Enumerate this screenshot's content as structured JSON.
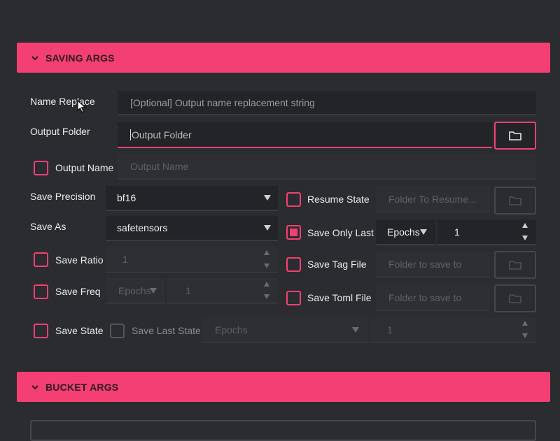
{
  "sections": {
    "saving": "SAVING ARGS",
    "bucket": "BUCKET ARGS"
  },
  "fields": {
    "name_replace": {
      "label": "Name Replace",
      "placeholder": "[Optional] Output name replacement string"
    },
    "output_folder": {
      "label": "Output Folder",
      "placeholder": "Output Folder"
    },
    "output_name": {
      "label": "Output Name",
      "placeholder": "Output Name"
    },
    "save_precision": {
      "label": "Save Precision",
      "value": "bf16"
    },
    "save_as": {
      "label": "Save As",
      "value": "safetensors"
    },
    "save_ratio": {
      "label": "Save Ratio",
      "value": "1"
    },
    "save_freq": {
      "label": "Save Freq",
      "unit": "Epochs",
      "value": "1"
    },
    "save_state": {
      "label": "Save State"
    },
    "save_last_state": {
      "label": "Save Last State",
      "unit": "Epochs",
      "value": "1"
    },
    "resume_state": {
      "label": "Resume State",
      "placeholder": "Folder To Resume..."
    },
    "save_only_last": {
      "label": "Save Only Last",
      "unit": "Epochs",
      "value": "1"
    },
    "save_tag_file": {
      "label": "Save Tag File",
      "placeholder": "Folder to save to"
    },
    "save_toml_file": {
      "label": "Save Toml File",
      "placeholder": "Folder to save to"
    }
  },
  "colors": {
    "accent": "#f43f74",
    "background": "#2b2c2f",
    "input": "#232427"
  },
  "icons": {
    "folder": "folder-icon",
    "chevron": "chevron-down-icon",
    "cursor": "mouse-pointer-icon"
  }
}
